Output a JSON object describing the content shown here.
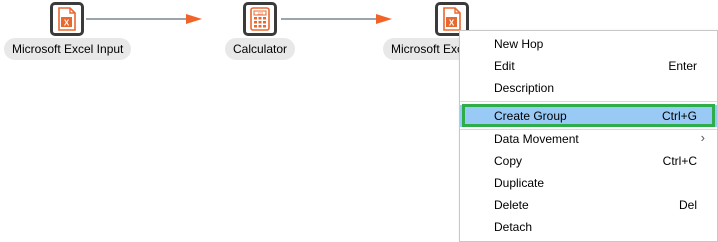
{
  "steps": [
    {
      "label": "Microsoft Excel Input",
      "icon": "excel-file-icon"
    },
    {
      "label": "Calculator",
      "icon": "calculator-icon"
    },
    {
      "label": "Microsoft Excel Output",
      "icon": "excel-file-icon"
    }
  ],
  "colors": {
    "hop": "#5d6f80",
    "arrow": "#f2632a",
    "icon_accent": "#e8682f",
    "highlight": "#99c9f5",
    "highlight_border": "#2eae4a"
  },
  "context_menu": {
    "items": [
      {
        "label": "New Hop",
        "shortcut": ""
      },
      {
        "label": "Edit",
        "shortcut": "Enter"
      },
      {
        "label": "Description",
        "shortcut": ""
      },
      {
        "label": "Create Group",
        "shortcut": "Ctrl+G",
        "highlighted": true
      },
      {
        "label": "Data Movement",
        "shortcut": "",
        "submenu": true
      },
      {
        "label": "Copy",
        "shortcut": "Ctrl+C"
      },
      {
        "label": "Duplicate",
        "shortcut": ""
      },
      {
        "label": "Delete",
        "shortcut": "Del"
      },
      {
        "label": "Detach",
        "shortcut": ""
      }
    ]
  }
}
